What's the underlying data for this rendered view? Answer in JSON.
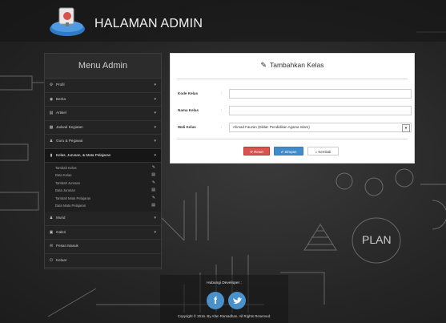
{
  "header": {
    "title": "HALAMAN ADMIN"
  },
  "sidebar": {
    "title": "Menu Admin",
    "items": [
      {
        "label": "Profil",
        "icon": "gear-icon"
      },
      {
        "label": "Berita",
        "icon": "globe-icon"
      },
      {
        "label": "Artikel",
        "icon": "article-icon"
      },
      {
        "label": "Jadwal Kegiatan",
        "icon": "calendar-icon"
      },
      {
        "label": "Guru & Pegawai",
        "icon": "user-icon"
      }
    ],
    "active_item": {
      "label": "Kelas, Jurusan, & Mata Pelajaran",
      "icon": "bookmark-icon"
    },
    "submenu": [
      {
        "label": "Tambah Kelas",
        "icon": "pencil-icon"
      },
      {
        "label": "Data Kelas",
        "icon": "list-icon"
      },
      {
        "label": "Tambah Jurusan",
        "icon": "pencil-icon"
      },
      {
        "label": "Data Jurusan",
        "icon": "list-icon"
      },
      {
        "label": "Tambah Mata Pelajaran",
        "icon": "pencil-icon"
      },
      {
        "label": "Data Mata Pelajaran",
        "icon": "list-icon"
      }
    ],
    "items_after": [
      {
        "label": "Murid",
        "icon": "user-icon",
        "chevron": true
      },
      {
        "label": "Galeri",
        "icon": "image-icon",
        "chevron": true
      },
      {
        "label": "Pesan Masuk",
        "icon": "envelope-icon",
        "chevron": false
      },
      {
        "label": "Keluar",
        "icon": "power-icon",
        "chevron": false
      }
    ]
  },
  "form": {
    "title": "Tambahkan Kelas",
    "fields": [
      {
        "label": "Kode Kelas",
        "colon": ":",
        "value": ""
      },
      {
        "label": "Nama Kelas",
        "colon": ":",
        "value": ""
      }
    ],
    "select": {
      "label": "Wali Kelas",
      "colon": ":",
      "selected": "Ahmad Fauzan (Diklat: Pendidikan Agama Islam)"
    },
    "buttons": {
      "reset": "Reset",
      "save": "Simpan",
      "back": "Kembali"
    }
  },
  "footer": {
    "developer_label": "Hubungi Developer :",
    "copyright": "Copyright © 2016. By Afan Ramadhan. All Rights Reserved."
  },
  "colors": {
    "danger": "#d9534f",
    "primary": "#428bca",
    "social": "#4a90c9"
  }
}
